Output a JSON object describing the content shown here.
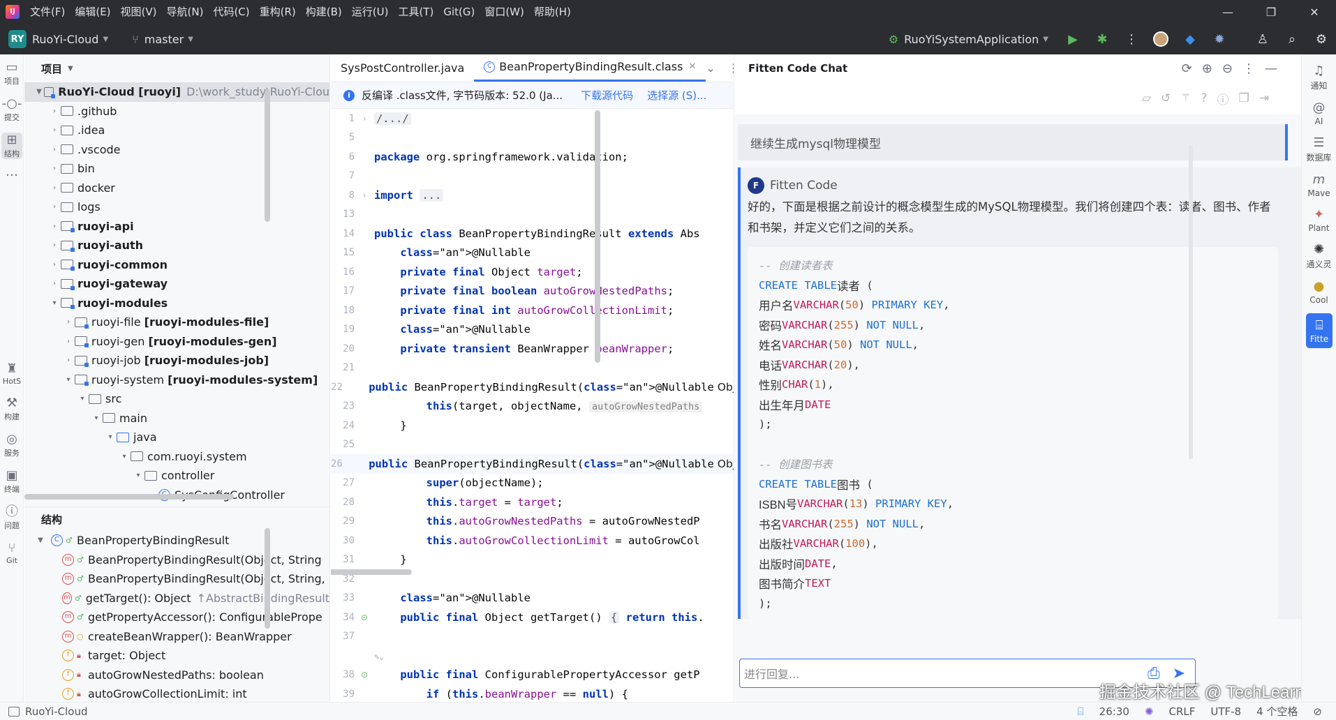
{
  "titlebar": {
    "menu": [
      "文件(F)",
      "编辑(E)",
      "视图(V)",
      "导航(N)",
      "代码(C)",
      "重构(R)",
      "构建(B)",
      "运行(U)",
      "工具(T)",
      "Git(G)",
      "窗口(W)",
      "帮助(H)"
    ]
  },
  "toolbar": {
    "project_badge": "RY",
    "project_name": "RuoYi-Cloud",
    "branch": "master",
    "run_config": "RuoYiSystemApplication"
  },
  "left_strip": [
    {
      "label": "项目",
      "icon": "folder-icon"
    },
    {
      "label": "提交",
      "icon": "commit-icon"
    },
    {
      "label": "结构",
      "icon": "structure-icon"
    },
    {
      "label": "HotS",
      "icon": "hotswap-icon"
    },
    {
      "label": "构建",
      "icon": "hammer-icon"
    },
    {
      "label": "服务",
      "icon": "services-icon"
    },
    {
      "label": "终端",
      "icon": "terminal-icon"
    },
    {
      "label": "问题",
      "icon": "problems-icon"
    },
    {
      "label": "Git",
      "icon": "git-icon"
    }
  ],
  "project_panel": {
    "title": "项目",
    "root": {
      "name": "RuoYi-Cloud [ruoyi]",
      "path": "D:\\work_study\\RuoYi-Clou"
    },
    "items": [
      {
        "name": ".github",
        "bold": false
      },
      {
        "name": ".idea",
        "bold": false
      },
      {
        "name": ".vscode",
        "bold": false
      },
      {
        "name": "bin",
        "bold": false
      },
      {
        "name": "docker",
        "bold": false
      },
      {
        "name": "logs",
        "bold": false
      },
      {
        "name": "ruoyi-api",
        "bold": true
      },
      {
        "name": "ruoyi-auth",
        "bold": true
      },
      {
        "name": "ruoyi-common",
        "bold": true
      },
      {
        "name": "ruoyi-gateway",
        "bold": true
      },
      {
        "name": "ruoyi-modules",
        "bold": true
      }
    ],
    "sub_modules": [
      {
        "name": "ruoyi-file",
        "tag": "[ruoyi-modules-file]"
      },
      {
        "name": "ruoyi-gen",
        "tag": "[ruoyi-modules-gen]"
      },
      {
        "name": "ruoyi-job",
        "tag": "[ruoyi-modules-job]"
      },
      {
        "name": "ruoyi-system",
        "tag": "[ruoyi-modules-system]"
      }
    ],
    "deep": [
      "src",
      "main",
      "java",
      "com.ruoyi.system",
      "controller",
      "SysConfigController"
    ]
  },
  "structure_panel": {
    "title": "结构",
    "class_name": "BeanPropertyBindingResult",
    "members": [
      {
        "kind": "m",
        "text": "BeanPropertyBindingResult(Object, String",
        "extra": ""
      },
      {
        "kind": "m",
        "text": "BeanPropertyBindingResult(Object, String,",
        "extra": ""
      },
      {
        "kind": "m",
        "text": "getTarget(): Object",
        "extra": "↑AbstractBindingResult"
      },
      {
        "kind": "m",
        "text": "getPropertyAccessor(): ConfigurablePrope",
        "extra": ""
      },
      {
        "kind": "m2",
        "text": "createBeanWrapper(): BeanWrapper",
        "extra": ""
      },
      {
        "kind": "f",
        "text": "target: Object",
        "extra": ""
      },
      {
        "kind": "f",
        "text": "autoGrowNestedPaths: boolean",
        "extra": ""
      },
      {
        "kind": "f",
        "text": "autoGrowCollectionLimit: int",
        "extra": ""
      }
    ]
  },
  "editor": {
    "tabs": [
      {
        "label": "SysPostController.java",
        "active": false
      },
      {
        "label": "BeanPropertyBindingResult.class",
        "active": true
      }
    ],
    "banner": {
      "text": "反编译 .class文件, 字节码版本: 52.0 (Ja...",
      "download": "下载源代码",
      "choose": "选择源 (S)..."
    },
    "lines": [
      {
        "n": "1",
        "t": "/.../"
      },
      {
        "n": "5",
        "t": ""
      },
      {
        "n": "6",
        "t": "package org.springframework.validation;"
      },
      {
        "n": "7",
        "t": ""
      },
      {
        "n": "8",
        "t": "import ..."
      },
      {
        "n": "13",
        "t": ""
      },
      {
        "n": "14",
        "t": "public class BeanPropertyBindingResult extends Abs"
      },
      {
        "n": "15",
        "t": "    @Nullable"
      },
      {
        "n": "16",
        "t": "    private final Object target;"
      },
      {
        "n": "17",
        "t": "    private final boolean autoGrowNestedPaths;"
      },
      {
        "n": "18",
        "t": "    private final int autoGrowCollectionLimit;"
      },
      {
        "n": "19",
        "t": "    @Nullable"
      },
      {
        "n": "20",
        "t": "    private transient BeanWrapper beanWrapper;"
      },
      {
        "n": "21",
        "t": ""
      },
      {
        "n": "22",
        "t": "    public BeanPropertyBindingResult(@Nullable Obj"
      },
      {
        "n": "23",
        "t": "        this(target, objectName,"
      },
      {
        "n": "24",
        "t": "    }"
      },
      {
        "n": "25",
        "t": ""
      },
      {
        "n": "26",
        "t": "    public BeanPropertyBindingResult(@Nullable Obj"
      },
      {
        "n": "27",
        "t": "        super(objectName);"
      },
      {
        "n": "28",
        "t": "        this.target = target;"
      },
      {
        "n": "29",
        "t": "        this.autoGrowNestedPaths = autoGrowNestedP"
      },
      {
        "n": "30",
        "t": "        this.autoGrowCollectionLimit = autoGrowCol"
      },
      {
        "n": "31",
        "t": "    }"
      },
      {
        "n": "32",
        "t": ""
      },
      {
        "n": "33",
        "t": "    @Nullable"
      },
      {
        "n": "34",
        "t": "    public final Object getTarget() { return this."
      },
      {
        "n": "37",
        "t": ""
      },
      {
        "n": "",
        "t": ""
      },
      {
        "n": "38",
        "t": "    public final ConfigurablePropertyAccessor getP"
      },
      {
        "n": "39",
        "t": "        if (this.beanWrapper == null) {"
      }
    ],
    "hint_23": "autoGrowNestedPaths",
    "current_line": "26"
  },
  "chat": {
    "title": "Fitten Code Chat",
    "user_message": "继续生成mysql物理模型",
    "bot_name": "Fitten Code",
    "bot_text": "好的，下面是根据之前设计的概念模型生成的MySQL物理模型。我们将创建四个表：读者、图书、作者和书架，并定义它们之间的关系。",
    "sql": {
      "c1": "-- 创建读者表",
      "t1": "读者",
      "t1_cols": [
        {
          "name": "用户名",
          "type": "VARCHAR",
          "len": "50",
          "extra": "PRIMARY KEY"
        },
        {
          "name": "密码",
          "type": "VARCHAR",
          "len": "255",
          "extra": "NOT NULL"
        },
        {
          "name": "姓名",
          "type": "VARCHAR",
          "len": "50",
          "extra": "NOT NULL"
        },
        {
          "name": "电话",
          "type": "VARCHAR",
          "len": "20",
          "extra": ""
        },
        {
          "name": "性别",
          "type": "CHAR",
          "len": "1",
          "extra": ""
        },
        {
          "name": "出生年月",
          "type": "DATE",
          "len": "",
          "extra": ""
        }
      ],
      "c2": "-- 创建图书表",
      "t2": "图书",
      "t2_cols": [
        {
          "name": "ISBN号",
          "type": "VARCHAR",
          "len": "13",
          "extra": "PRIMARY KEY"
        },
        {
          "name": "书名",
          "type": "VARCHAR",
          "len": "255",
          "extra": "NOT NULL"
        },
        {
          "name": "出版社",
          "type": "VARCHAR",
          "len": "100",
          "extra": ""
        },
        {
          "name": "出版时间",
          "type": "DATE",
          "len": "",
          "extra": ""
        },
        {
          "name": "图书简介",
          "type": "TEXT",
          "len": "",
          "extra": ""
        }
      ],
      "kw_create": "CREATE TABLE"
    },
    "input_placeholder": "进行回复...",
    "watermark": "掘金技术社区 @ TechLearn"
  },
  "right_strip": [
    {
      "label": "通知",
      "icon": "bell-icon"
    },
    {
      "label": "AI",
      "icon": "ai-icon"
    },
    {
      "label": "数据库",
      "icon": "database-icon"
    },
    {
      "label": "Mave",
      "icon": "maven-icon"
    },
    {
      "label": "Plant",
      "icon": "plantuml-icon"
    },
    {
      "label": "通义灵",
      "icon": "tongyi-icon"
    },
    {
      "label": "Cool",
      "icon": "cool-icon"
    },
    {
      "label": "Fitte",
      "icon": "fitten-icon"
    }
  ],
  "statusbar": {
    "project": "RuoYi-Cloud",
    "position": "26:30",
    "line_sep": "CRLF",
    "encoding": "UTF-8",
    "indent": "4 个空格"
  }
}
